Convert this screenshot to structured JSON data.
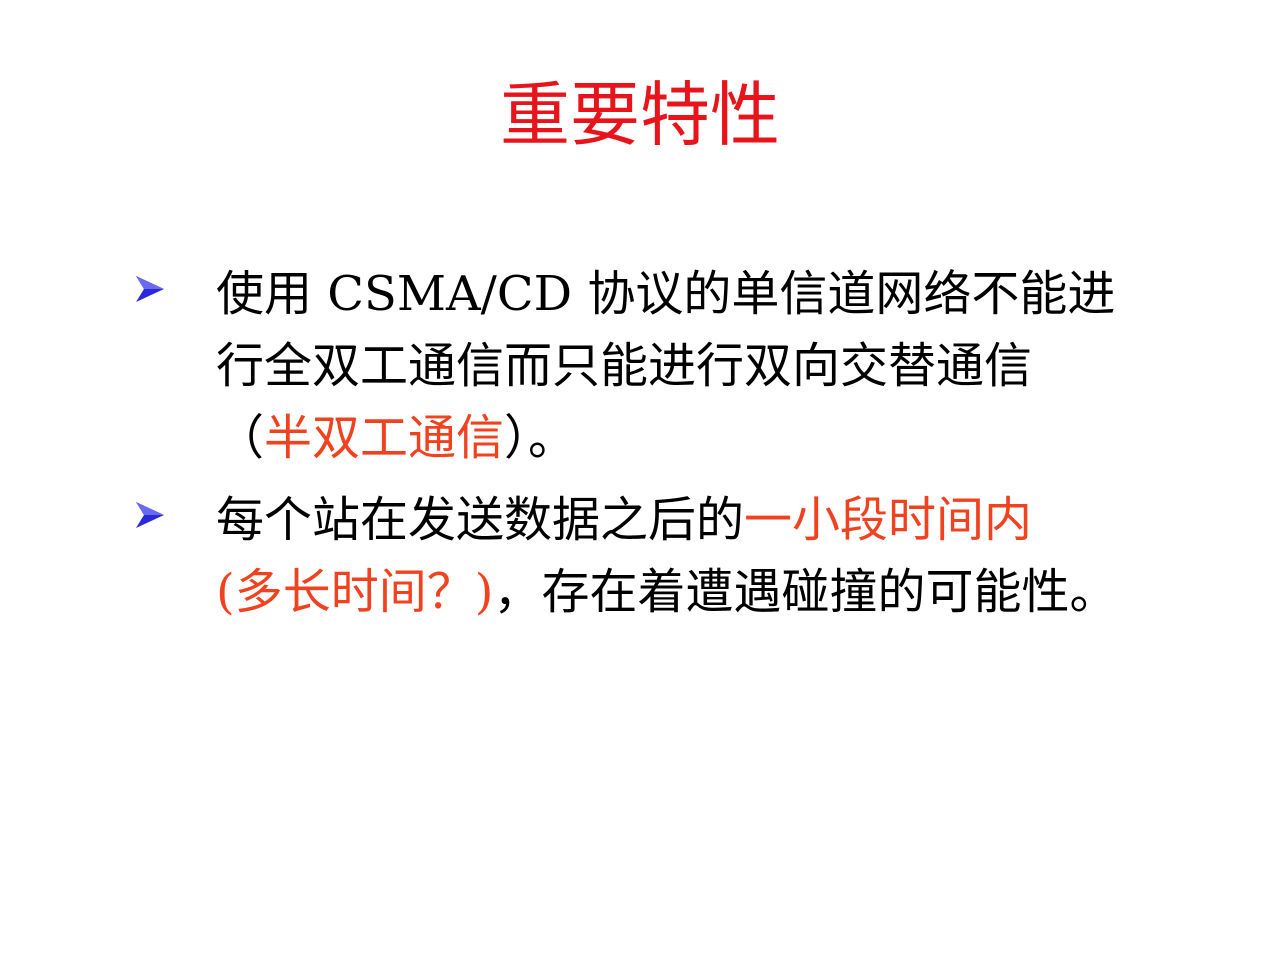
{
  "slide": {
    "title": "重要特性",
    "colors": {
      "title": "#e8141b",
      "highlight": "#f0421e",
      "body": "#000000",
      "bullet_marker": "#2a2ad8"
    },
    "bullet_marker_icon": "arrowhead-bullet-icon",
    "bullets": [
      {
        "line1": "使用 CSMA/CD 协议的单信道网络不能进",
        "line2": "行全双工通信而只能进行双向交替通信",
        "line3_open": "（",
        "line3_highlight": "半双工通信",
        "line3_close": "）。"
      },
      {
        "line1_text": "每个站在发送数据之后的",
        "line1_highlight": "一小段时间内",
        "line2_highlight": "(多长时间？)",
        "line2_text": "，存在着遭遇碰撞的可能性。"
      }
    ]
  }
}
